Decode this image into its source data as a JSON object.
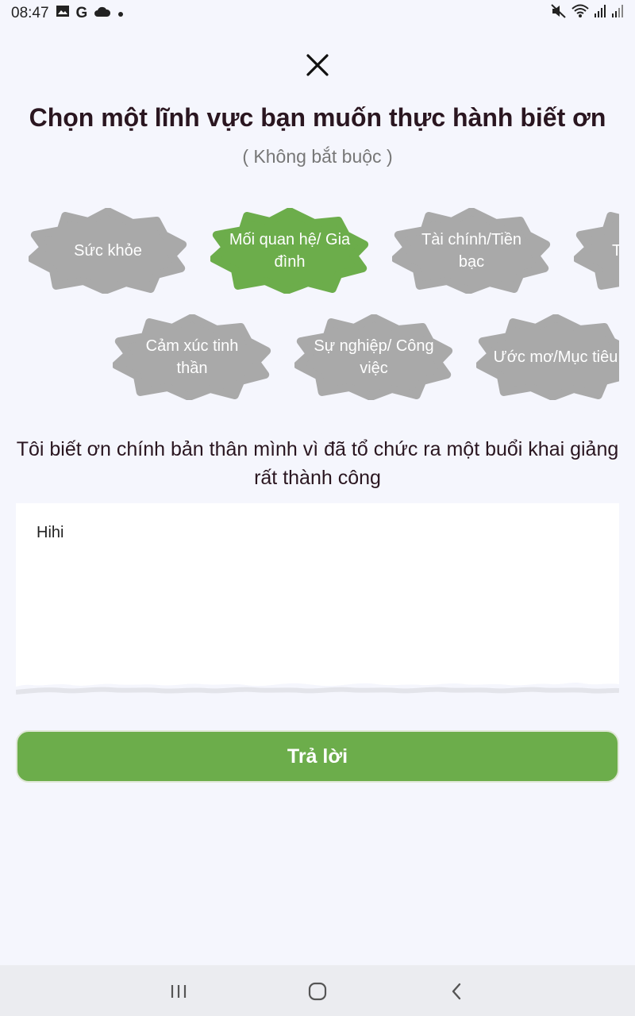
{
  "status_bar": {
    "time": "08:47",
    "left_icons": [
      "image-icon",
      "google-icon",
      "cloud-icon",
      "dot-icon"
    ],
    "right_icons": [
      "mute-icon",
      "wifi-icon",
      "signal-icon",
      "signal-icon"
    ]
  },
  "header": {
    "title": "Chọn một lĩnh vực bạn muốn thực hành biết ơn",
    "subtitle": "( Không bắt buộc )"
  },
  "categories": [
    {
      "label": "Sức khỏe",
      "selected": false
    },
    {
      "label": "Mối quan hệ/ Gia đình",
      "selected": true
    },
    {
      "label": "Tài chính/Tiền bạc",
      "selected": false
    },
    {
      "label": "T",
      "selected": false
    },
    {
      "label": "Cảm xúc tinh thần",
      "selected": false
    },
    {
      "label": "Sự nghiệp/ Công việc",
      "selected": false
    },
    {
      "label": "Ước mơ/Mục tiêu",
      "selected": false
    }
  ],
  "colors": {
    "selected": "#6cad4b",
    "unselected": "#a9a9a9",
    "background": "#f5f6fd"
  },
  "prompt": "Tôi biết ơn chính bản thân mình vì đã tổ chức ra một buổi khai giảng rất thành công",
  "answer": {
    "value": "Hihi"
  },
  "submit_label": "Trả lời",
  "nav": {
    "icons": [
      "recent-apps-icon",
      "home-icon",
      "back-icon"
    ]
  }
}
